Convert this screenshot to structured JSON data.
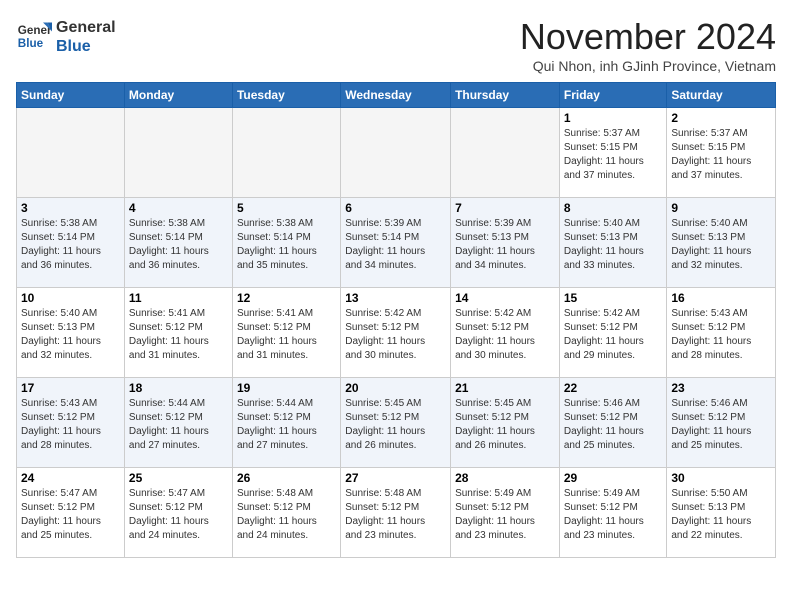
{
  "header": {
    "logo_line1": "General",
    "logo_line2": "Blue",
    "month_title": "November 2024",
    "subtitle": "Qui Nhon, inh GJinh Province, Vietnam"
  },
  "weekdays": [
    "Sunday",
    "Monday",
    "Tuesday",
    "Wednesday",
    "Thursday",
    "Friday",
    "Saturday"
  ],
  "weeks": [
    [
      {
        "day": "",
        "empty": true
      },
      {
        "day": "",
        "empty": true
      },
      {
        "day": "",
        "empty": true
      },
      {
        "day": "",
        "empty": true
      },
      {
        "day": "",
        "empty": true
      },
      {
        "day": "1",
        "info": "Sunrise: 5:37 AM\nSunset: 5:15 PM\nDaylight: 11 hours\nand 37 minutes."
      },
      {
        "day": "2",
        "info": "Sunrise: 5:37 AM\nSunset: 5:15 PM\nDaylight: 11 hours\nand 37 minutes."
      }
    ],
    [
      {
        "day": "3",
        "info": "Sunrise: 5:38 AM\nSunset: 5:14 PM\nDaylight: 11 hours\nand 36 minutes."
      },
      {
        "day": "4",
        "info": "Sunrise: 5:38 AM\nSunset: 5:14 PM\nDaylight: 11 hours\nand 36 minutes."
      },
      {
        "day": "5",
        "info": "Sunrise: 5:38 AM\nSunset: 5:14 PM\nDaylight: 11 hours\nand 35 minutes."
      },
      {
        "day": "6",
        "info": "Sunrise: 5:39 AM\nSunset: 5:14 PM\nDaylight: 11 hours\nand 34 minutes."
      },
      {
        "day": "7",
        "info": "Sunrise: 5:39 AM\nSunset: 5:13 PM\nDaylight: 11 hours\nand 34 minutes."
      },
      {
        "day": "8",
        "info": "Sunrise: 5:40 AM\nSunset: 5:13 PM\nDaylight: 11 hours\nand 33 minutes."
      },
      {
        "day": "9",
        "info": "Sunrise: 5:40 AM\nSunset: 5:13 PM\nDaylight: 11 hours\nand 32 minutes."
      }
    ],
    [
      {
        "day": "10",
        "info": "Sunrise: 5:40 AM\nSunset: 5:13 PM\nDaylight: 11 hours\nand 32 minutes."
      },
      {
        "day": "11",
        "info": "Sunrise: 5:41 AM\nSunset: 5:12 PM\nDaylight: 11 hours\nand 31 minutes."
      },
      {
        "day": "12",
        "info": "Sunrise: 5:41 AM\nSunset: 5:12 PM\nDaylight: 11 hours\nand 31 minutes."
      },
      {
        "day": "13",
        "info": "Sunrise: 5:42 AM\nSunset: 5:12 PM\nDaylight: 11 hours\nand 30 minutes."
      },
      {
        "day": "14",
        "info": "Sunrise: 5:42 AM\nSunset: 5:12 PM\nDaylight: 11 hours\nand 30 minutes."
      },
      {
        "day": "15",
        "info": "Sunrise: 5:42 AM\nSunset: 5:12 PM\nDaylight: 11 hours\nand 29 minutes."
      },
      {
        "day": "16",
        "info": "Sunrise: 5:43 AM\nSunset: 5:12 PM\nDaylight: 11 hours\nand 28 minutes."
      }
    ],
    [
      {
        "day": "17",
        "info": "Sunrise: 5:43 AM\nSunset: 5:12 PM\nDaylight: 11 hours\nand 28 minutes."
      },
      {
        "day": "18",
        "info": "Sunrise: 5:44 AM\nSunset: 5:12 PM\nDaylight: 11 hours\nand 27 minutes."
      },
      {
        "day": "19",
        "info": "Sunrise: 5:44 AM\nSunset: 5:12 PM\nDaylight: 11 hours\nand 27 minutes."
      },
      {
        "day": "20",
        "info": "Sunrise: 5:45 AM\nSunset: 5:12 PM\nDaylight: 11 hours\nand 26 minutes."
      },
      {
        "day": "21",
        "info": "Sunrise: 5:45 AM\nSunset: 5:12 PM\nDaylight: 11 hours\nand 26 minutes."
      },
      {
        "day": "22",
        "info": "Sunrise: 5:46 AM\nSunset: 5:12 PM\nDaylight: 11 hours\nand 25 minutes."
      },
      {
        "day": "23",
        "info": "Sunrise: 5:46 AM\nSunset: 5:12 PM\nDaylight: 11 hours\nand 25 minutes."
      }
    ],
    [
      {
        "day": "24",
        "info": "Sunrise: 5:47 AM\nSunset: 5:12 PM\nDaylight: 11 hours\nand 25 minutes."
      },
      {
        "day": "25",
        "info": "Sunrise: 5:47 AM\nSunset: 5:12 PM\nDaylight: 11 hours\nand 24 minutes."
      },
      {
        "day": "26",
        "info": "Sunrise: 5:48 AM\nSunset: 5:12 PM\nDaylight: 11 hours\nand 24 minutes."
      },
      {
        "day": "27",
        "info": "Sunrise: 5:48 AM\nSunset: 5:12 PM\nDaylight: 11 hours\nand 23 minutes."
      },
      {
        "day": "28",
        "info": "Sunrise: 5:49 AM\nSunset: 5:12 PM\nDaylight: 11 hours\nand 23 minutes."
      },
      {
        "day": "29",
        "info": "Sunrise: 5:49 AM\nSunset: 5:12 PM\nDaylight: 11 hours\nand 23 minutes."
      },
      {
        "day": "30",
        "info": "Sunrise: 5:50 AM\nSunset: 5:13 PM\nDaylight: 11 hours\nand 22 minutes."
      }
    ]
  ]
}
